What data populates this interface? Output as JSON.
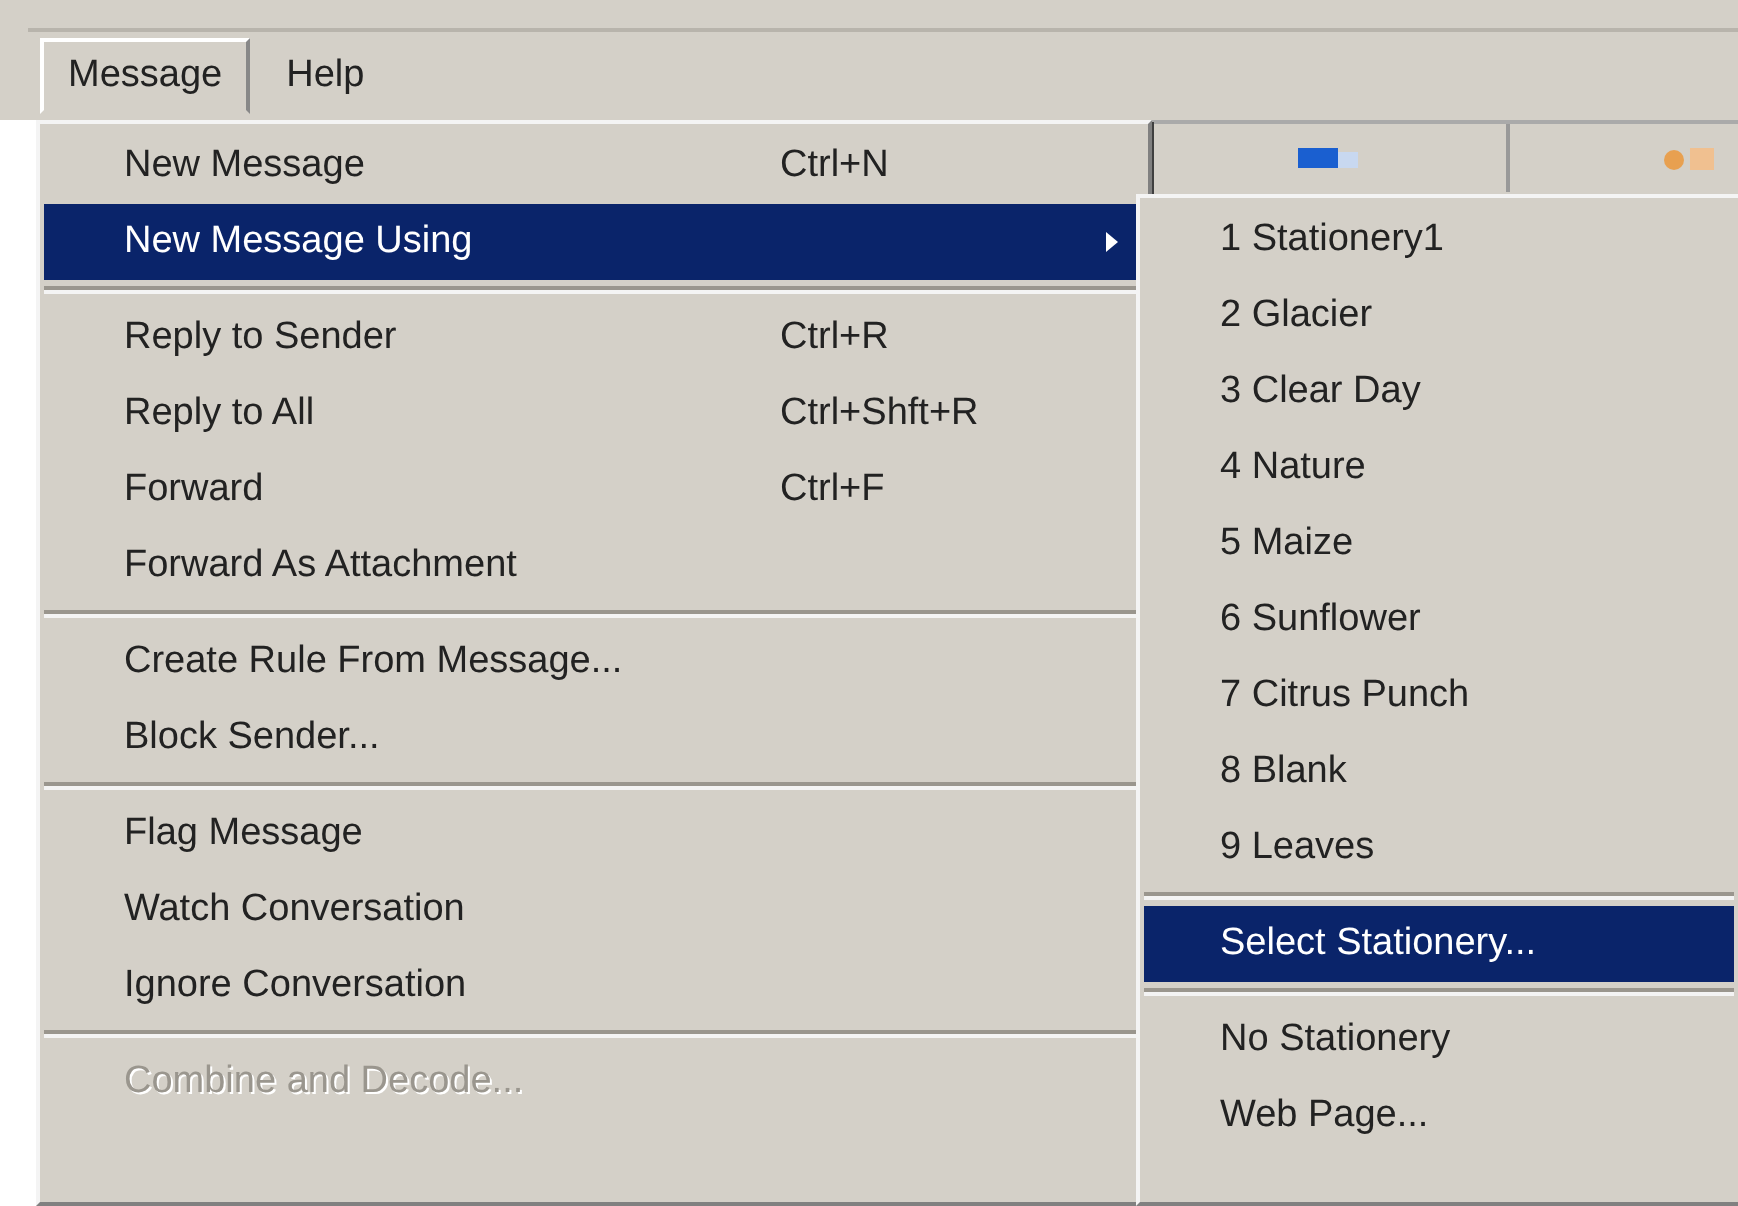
{
  "menubar": [
    {
      "label": "Message",
      "selected": true
    },
    {
      "label": "Help",
      "selected": false
    }
  ],
  "menu": [
    {
      "kind": "item",
      "label": "New Message",
      "shortcut": "Ctrl+N",
      "selected": false,
      "disabled": false
    },
    {
      "kind": "item",
      "label": "New Message Using",
      "submenu": true,
      "selected": true,
      "disabled": false
    },
    {
      "kind": "separator"
    },
    {
      "kind": "item",
      "label": "Reply to Sender",
      "shortcut": "Ctrl+R",
      "selected": false,
      "disabled": false
    },
    {
      "kind": "item",
      "label": "Reply to All",
      "shortcut": "Ctrl+Shft+R",
      "selected": false,
      "disabled": false
    },
    {
      "kind": "item",
      "label": "Forward",
      "shortcut": "Ctrl+F",
      "selected": false,
      "disabled": false
    },
    {
      "kind": "item",
      "label": "Forward As Attachment",
      "selected": false,
      "disabled": false
    },
    {
      "kind": "separator"
    },
    {
      "kind": "item",
      "label": "Create Rule From Message...",
      "selected": false,
      "disabled": false
    },
    {
      "kind": "item",
      "label": "Block Sender...",
      "selected": false,
      "disabled": false
    },
    {
      "kind": "separator"
    },
    {
      "kind": "item",
      "label": "Flag Message",
      "selected": false,
      "disabled": false
    },
    {
      "kind": "item",
      "label": "Watch Conversation",
      "selected": false,
      "disabled": false
    },
    {
      "kind": "item",
      "label": "Ignore Conversation",
      "selected": false,
      "disabled": false
    },
    {
      "kind": "separator"
    },
    {
      "kind": "item",
      "label": "Combine and Decode...",
      "selected": false,
      "disabled": true
    }
  ],
  "submenu": [
    {
      "kind": "item",
      "label": "1 Stationery1",
      "selected": false
    },
    {
      "kind": "item",
      "label": "2 Glacier",
      "selected": false
    },
    {
      "kind": "item",
      "label": "3 Clear Day",
      "selected": false
    },
    {
      "kind": "item",
      "label": "4 Nature",
      "selected": false
    },
    {
      "kind": "item",
      "label": "5 Maize",
      "selected": false
    },
    {
      "kind": "item",
      "label": "6 Sunflower",
      "selected": false
    },
    {
      "kind": "item",
      "label": "7 Citrus Punch",
      "selected": false
    },
    {
      "kind": "item",
      "label": "8 Blank",
      "selected": false
    },
    {
      "kind": "item",
      "label": "9 Leaves",
      "selected": false
    },
    {
      "kind": "separator"
    },
    {
      "kind": "item",
      "label": "Select Stationery...",
      "selected": true
    },
    {
      "kind": "separator"
    },
    {
      "kind": "item",
      "label": "No Stationery",
      "selected": false
    },
    {
      "kind": "item",
      "label": "Web Page...",
      "selected": false
    }
  ]
}
